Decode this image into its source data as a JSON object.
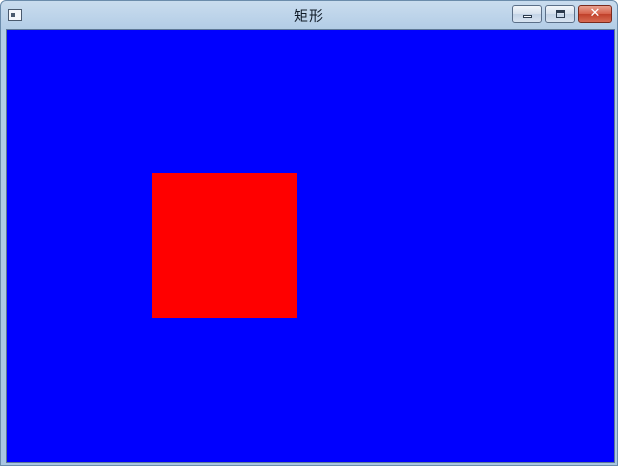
{
  "window": {
    "title": "矩形",
    "background_color": "#0000ff",
    "shape_color": "#ff0000",
    "icons": {
      "app": "app-icon",
      "minimize": "minimize-icon",
      "maximize": "maximize-icon",
      "close": "close-icon"
    }
  }
}
